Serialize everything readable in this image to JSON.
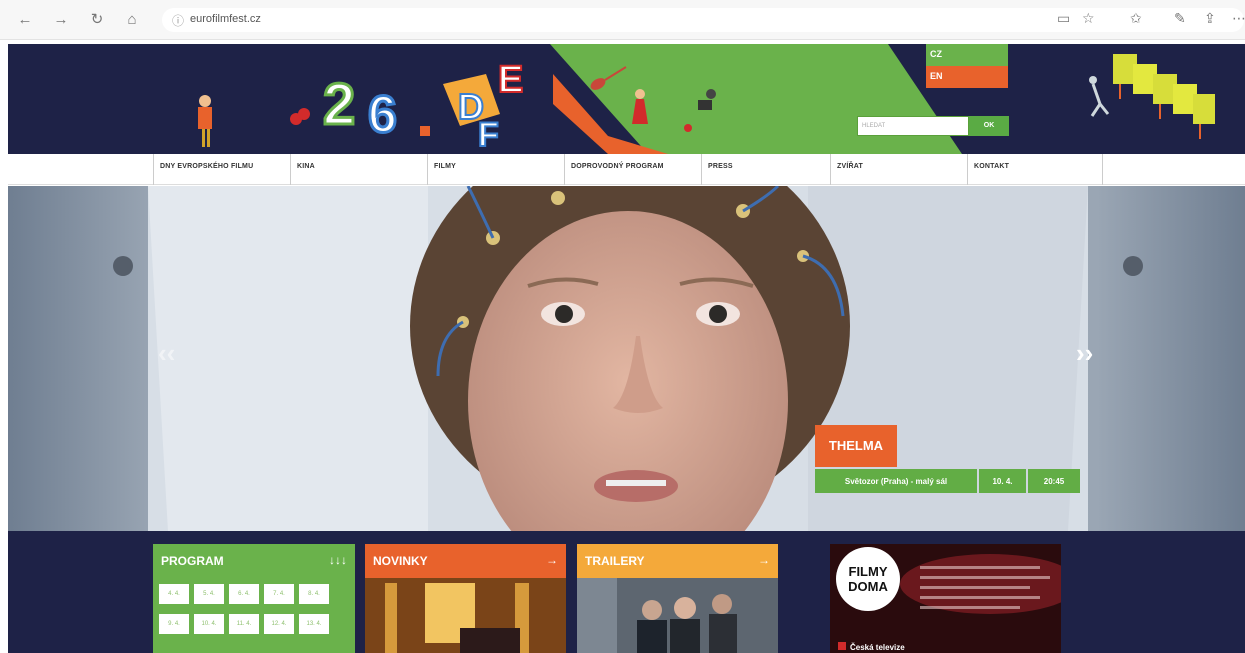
{
  "browser": {
    "url": "eurofilmfest.cz"
  },
  "header": {
    "festival_number": "26.",
    "festival_letters": "DEF"
  },
  "lang": {
    "cz": "CZ",
    "en": "EN"
  },
  "search": {
    "placeholder": "HLEDAT",
    "button": "OK"
  },
  "nav": [
    "DNY EVROPSKÉHO FILMU",
    "KINA",
    "FILMY",
    "DOPROVODNÝ PROGRAM",
    "PRESS",
    "ZVÍŘAT",
    "KONTAKT"
  ],
  "hero": {
    "film": "THELMA",
    "venue": "Světozor (Praha) - malý sál",
    "date": "10. 4.",
    "time": "20:45"
  },
  "cards": {
    "program": "PROGRAM",
    "program_icon": "↓↓↓",
    "novinky": "NOVINKY",
    "trailery": "TRAILERY",
    "arrow": "→"
  },
  "days": [
    "4. 4.",
    "5. 4.",
    "6. 4.",
    "7. 4.",
    "8. 4.",
    "9. 4.",
    "10. 4.",
    "11. 4.",
    "12. 4.",
    "13. 4."
  ],
  "ad": {
    "logo_line1": "FILMY",
    "logo_line2": "DOMA",
    "brand": "Česká televize"
  }
}
